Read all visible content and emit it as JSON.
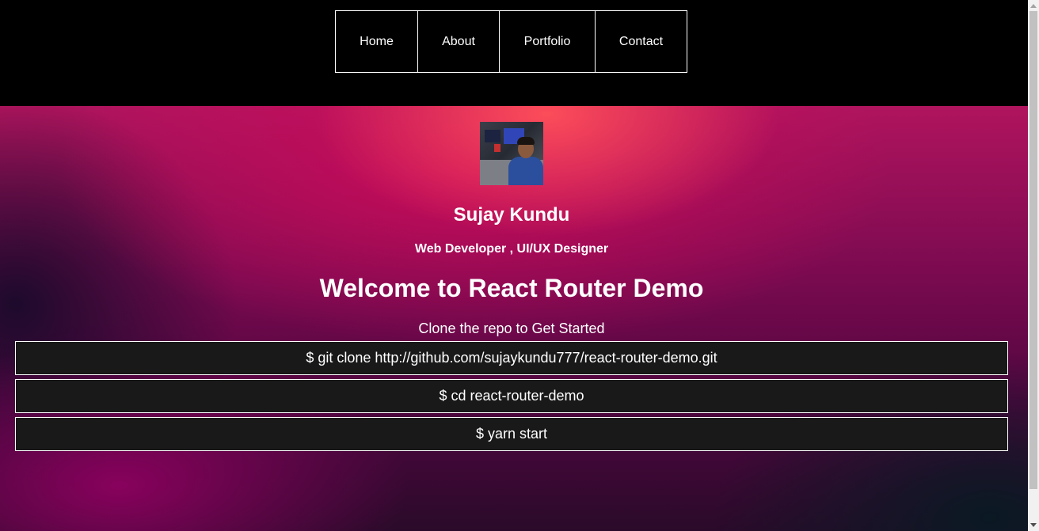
{
  "nav": {
    "items": [
      {
        "label": "Home"
      },
      {
        "label": "About"
      },
      {
        "label": "Portfolio"
      },
      {
        "label": "Contact"
      }
    ]
  },
  "profile": {
    "name": "Sujay Kundu",
    "role": "Web Developer , UI/UX Designer"
  },
  "main": {
    "heading": "Welcome to React Router Demo",
    "intro": "Clone the repo to Get Started",
    "commands": [
      "$ git clone http://github.com/sujaykundu777/react-router-demo.git",
      "$ cd react-router-demo",
      "$ yarn start"
    ]
  },
  "colors": {
    "nav_background": "#000000",
    "command_background": "#191919",
    "text": "#ffffff",
    "hero_accent": "#d6105f"
  }
}
